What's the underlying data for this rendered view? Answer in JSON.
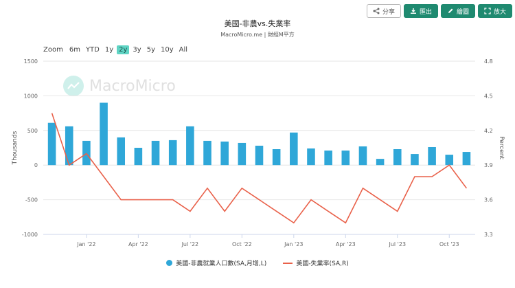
{
  "toolbar": {
    "share_label": "分享",
    "export_label": "匯出",
    "draw_label": "繪圖",
    "expand_label": "放大",
    "accent": "#1f8a70"
  },
  "header": {
    "title": "美國-非農vs.失業率",
    "subtitle": "MacroMicro.me | 財經M平方"
  },
  "range_selector": {
    "label": "Zoom",
    "options": [
      "6m",
      "YTD",
      "1y",
      "2y",
      "3y",
      "5y",
      "10y",
      "All"
    ],
    "selected": "2y"
  },
  "watermark": {
    "text": "MacroMicro"
  },
  "chart_data": {
    "type": "bar",
    "x": [
      "2021-11",
      "2021-12",
      "2022-01",
      "2022-02",
      "2022-03",
      "2022-04",
      "2022-05",
      "2022-06",
      "2022-07",
      "2022-08",
      "2022-09",
      "2022-10",
      "2022-11",
      "2022-12",
      "2023-01",
      "2023-02",
      "2023-03",
      "2023-04",
      "2023-05",
      "2023-06",
      "2023-07",
      "2023-08",
      "2023-09",
      "2023-10",
      "2023-11"
    ],
    "x_tick_labels": [
      {
        "at": "2022-01",
        "label": "Jan '22"
      },
      {
        "at": "2022-04",
        "label": "Apr '22"
      },
      {
        "at": "2022-07",
        "label": "Jul '22"
      },
      {
        "at": "2022-10",
        "label": "Oct '22"
      },
      {
        "at": "2023-01",
        "label": "Jan '23"
      },
      {
        "at": "2023-04",
        "label": "Apr '23"
      },
      {
        "at": "2023-07",
        "label": "Jul '23"
      },
      {
        "at": "2023-10",
        "label": "Oct '23"
      }
    ],
    "series": [
      {
        "name": "美國-非農就業人口數(SA,月增,L)",
        "type": "bar",
        "axis": "left",
        "color": "#2fa7d8",
        "values": [
          610,
          560,
          350,
          900,
          400,
          250,
          350,
          360,
          560,
          350,
          340,
          320,
          280,
          230,
          470,
          240,
          210,
          210,
          270,
          90,
          230,
          160,
          260,
          150,
          190
        ]
      },
      {
        "name": "美國-失業率(SA,R)",
        "type": "line",
        "axis": "right",
        "color": "#e9614a",
        "values": [
          4.35,
          3.9,
          4.0,
          3.8,
          3.6,
          3.6,
          3.6,
          3.6,
          3.5,
          3.7,
          3.5,
          3.7,
          3.6,
          3.5,
          3.4,
          3.6,
          3.5,
          3.4,
          3.7,
          3.6,
          3.5,
          3.8,
          3.8,
          3.9,
          3.7
        ]
      }
    ],
    "y_left": {
      "label": "Thousands",
      "min": -1000,
      "max": 1500,
      "ticks": [
        "-1000",
        "-500",
        "0",
        "500",
        "1000",
        "1500"
      ]
    },
    "y_right": {
      "label": "Percent",
      "min": 3.3,
      "max": 4.8,
      "ticks": [
        "3.3",
        "3.6",
        "3.9",
        "4.2",
        "4.5",
        "4.8"
      ]
    },
    "grid": "horizontal",
    "legend_position": "bottom"
  }
}
